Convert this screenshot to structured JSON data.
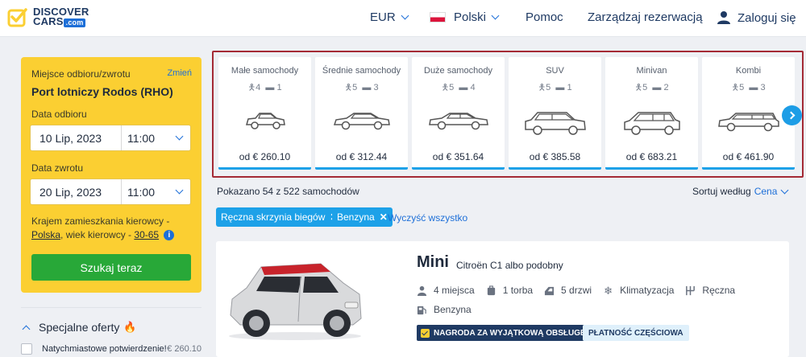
{
  "header": {
    "logo_line1": "DISCOVER",
    "logo_line2": "CARS",
    "logo_com": ".com",
    "currency": "EUR",
    "language": "Polski",
    "help": "Pomoc",
    "manage": "Zarządzaj rezerwacją",
    "login": "Zaloguj się"
  },
  "search": {
    "location_label": "Miejsce odbioru/zwrotu",
    "change_link": "Zmień",
    "location": "Port lotniczy Rodos (RHO)",
    "pickup_label": "Data odbioru",
    "pickup_date": "10  Lip, 2023",
    "pickup_time": "11:00",
    "return_label": "Data zwrotu",
    "return_date": "20  Lip, 2023",
    "return_time": "11:00",
    "note_prefix": "Krajem zamieszkania kierowcy -",
    "country": "Polska",
    "age_prefix": ", wiek kierowcy -",
    "age_range": "30-65",
    "button": "Szukaj teraz"
  },
  "special": {
    "title": "Specjalne oferty",
    "fire_icon": "🔥",
    "row_label": "Natychmiastowe potwierdzenie!",
    "row_price": "€ 260.10"
  },
  "categories": [
    {
      "name": "Małe samochody",
      "seats": "4",
      "bags": "1",
      "price": "od € 260.10",
      "icon": "small-car-icon"
    },
    {
      "name": "Średnie samochody",
      "seats": "5",
      "bags": "3",
      "price": "od € 312.44",
      "icon": "medium-car-icon"
    },
    {
      "name": "Duże samochody",
      "seats": "5",
      "bags": "4",
      "price": "od € 351.64",
      "icon": "large-car-icon"
    },
    {
      "name": "SUV",
      "seats": "5",
      "bags": "1",
      "price": "od € 385.58",
      "icon": "suv-icon"
    },
    {
      "name": "Minivan",
      "seats": "5",
      "bags": "2",
      "price": "od € 683.21",
      "icon": "minivan-icon"
    },
    {
      "name": "Kombi",
      "seats": "5",
      "bags": "3",
      "price": "od € 461.90",
      "icon": "estate-car-icon"
    }
  ],
  "results": {
    "count_text": "Pokazano 54 z 522 samochodów",
    "sort_label": "Sortuj według",
    "sort_value": "Cena"
  },
  "filters": {
    "chips": [
      "Ręczna skrzynia biegów",
      "Benzyna"
    ],
    "clear_all": "Wyczyść wszystko"
  },
  "car": {
    "title": "Mini",
    "subtitle": "Citroën C1 albo podobny",
    "seats": "4 miejsca",
    "bags": "1 torba",
    "doors": "5 drzwi",
    "ac": "Klimatyzacja",
    "transmission": "Ręczna",
    "fuel": "Benzyna",
    "award_badge": "NAGRODA ZA WYJĄTKOWĄ OBSŁUGĘ",
    "payment_badge": "PŁATNOŚĆ CZĘŚCIOWA",
    "body_color": "#d9dadc",
    "roof_color": "#c8232b"
  },
  "colors": {
    "accent_blue": "#1d6fd8",
    "search_yellow": "#fbcf32",
    "search_green": "#28a838",
    "strip_highlight": "#a42a35"
  }
}
